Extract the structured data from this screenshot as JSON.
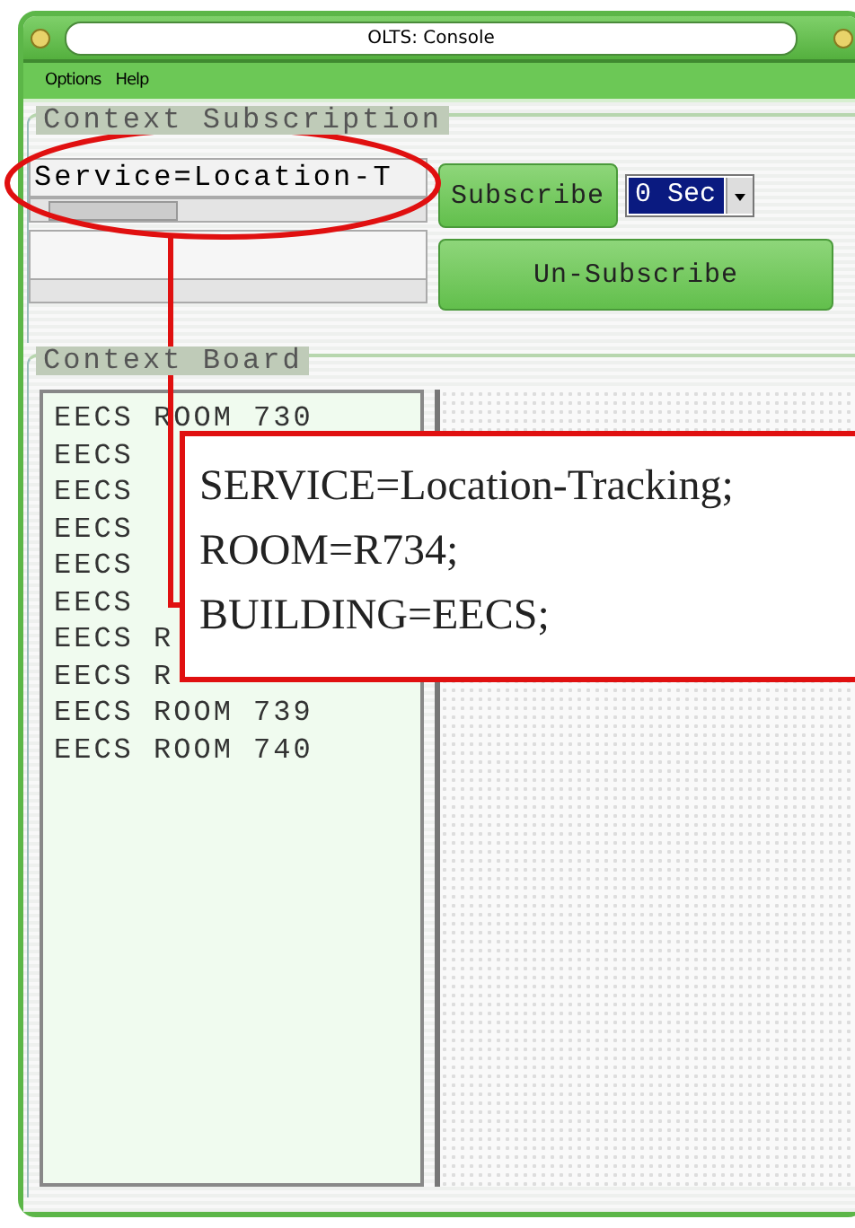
{
  "window": {
    "title": "OLTS: Console"
  },
  "menu": [
    "Options",
    "Help"
  ],
  "context_subscription": {
    "legend": "Context Subscription",
    "field_value": "Service=Location-T",
    "subscribe_button": "Subscribe",
    "interval": "0 Sec",
    "unsubscribe_button": "Un-Subscribe"
  },
  "context_board": {
    "legend": "Context Board",
    "items": [
      "EECS ROOM 730",
      "EECS",
      "EECS",
      "EECS",
      "EECS",
      "EECS",
      "EECS R",
      "EECS R",
      "EECS ROOM 739",
      "EECS ROOM 740"
    ]
  },
  "callout": {
    "lines": [
      "SERVICE=Location-Tracking;",
      "ROOM=R734;",
      "BUILDING=EECS;"
    ]
  }
}
